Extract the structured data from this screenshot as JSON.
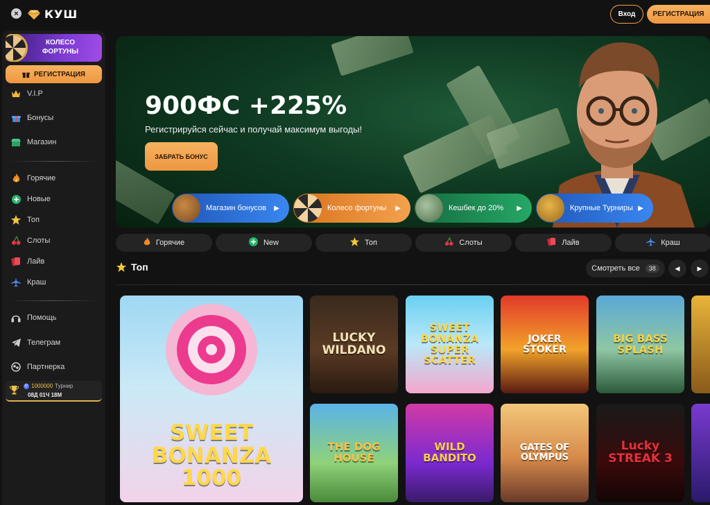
{
  "topbar": {
    "close_icon": "×",
    "logo_text": "КУШ",
    "login_label": "Вход",
    "register_label": "РЕГИСТРАЦИЯ"
  },
  "sidebar": {
    "wheel_label": "КОЛЕСО ФОРТУНЫ",
    "register_label": "РЕГИСТРАЦИЯ",
    "group1": [
      {
        "label": "V.I.P",
        "icon": "crown-icon"
      },
      {
        "label": "Бонусы",
        "icon": "gift-icon"
      },
      {
        "label": "Магазин",
        "icon": "shop-icon"
      }
    ],
    "group2": [
      {
        "label": "Горячие",
        "icon": "fire-icon"
      },
      {
        "label": "Новые",
        "icon": "plus-icon"
      },
      {
        "label": "Топ",
        "icon": "star-icon"
      },
      {
        "label": "Слоты",
        "icon": "cherry-icon"
      },
      {
        "label": "Лайв",
        "icon": "cards-icon"
      },
      {
        "label": "Краш",
        "icon": "plane-icon"
      }
    ],
    "group3": [
      {
        "label": "Помощь",
        "icon": "headphones-icon"
      },
      {
        "label": "Телеграм",
        "icon": "telegram-icon"
      },
      {
        "label": "Партнерка",
        "icon": "partner-icon"
      }
    ],
    "tournament": {
      "amount": "1000000",
      "label": "Турнир",
      "timer": "08Д 01Ч 18М"
    }
  },
  "hero": {
    "title": "900ФС +225%",
    "subtitle": "Регистрируйся сейчас и получай максимум выгоды!",
    "button_label": "ЗАБРАТЬ БОНУС",
    "pills": [
      {
        "label": "Магазин бонусов",
        "color": "#2f74e4"
      },
      {
        "label": "Колесо фортуны",
        "color": "#ec8a34"
      },
      {
        "label": "Кешбек до 20%",
        "color": "#1e8a55"
      },
      {
        "label": "Крупные Турниры",
        "color": "#2f74e4"
      }
    ]
  },
  "categories": [
    {
      "label": "Горячие",
      "icon": "fire-icon"
    },
    {
      "label": "New",
      "icon": "plus-icon"
    },
    {
      "label": "Топ",
      "icon": "star-icon"
    },
    {
      "label": "Слоты",
      "icon": "cherry-icon"
    },
    {
      "label": "Лайв",
      "icon": "cards-icon"
    },
    {
      "label": "Краш",
      "icon": "plane-icon"
    }
  ],
  "section": {
    "title": "Топ",
    "see_all_label": "Смотреть все",
    "count": "38",
    "prev_icon": "◀",
    "next_icon": "▶"
  },
  "games": [
    {
      "name": "SWEET BONANZA 1000"
    },
    {
      "name": "LUCKY WILDANO"
    },
    {
      "name": "SWEET BONANZA SUPER SCATTER"
    },
    {
      "name": "JOKER STOKER"
    },
    {
      "name": "BIG BASS SPLASH"
    },
    {
      "name": "THE DOG HOUSE"
    },
    {
      "name": "WILD BANDITO"
    },
    {
      "name": "GATES OF OLYMPUS"
    },
    {
      "name": "Lucky STREAK 3"
    }
  ]
}
